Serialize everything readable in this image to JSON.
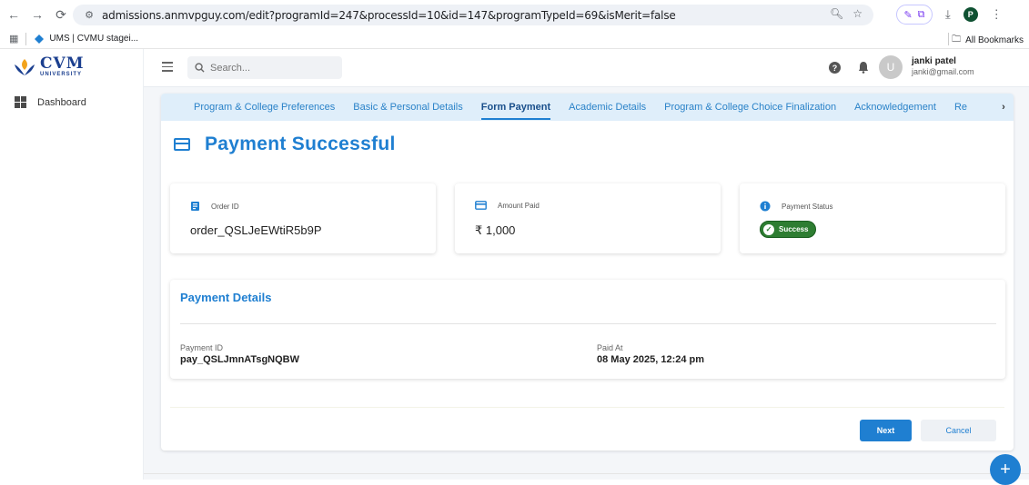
{
  "browser": {
    "url": "admissions.anmvpguy.com/edit?programId=247&processId=10&id=147&programTypeId=69&isMerit=false",
    "bookmark_1": "UMS | CVMU stagei...",
    "all_bookmarks": "All Bookmarks",
    "profile_initial": "P"
  },
  "sidebar": {
    "logo_main": "CVM",
    "logo_sub": "UNIVERSITY",
    "dashboard_label": "Dashboard"
  },
  "topbar": {
    "search_placeholder": "Search...",
    "avatar_initial": "U",
    "user_name": "janki patel",
    "user_email": "janki@gmail.com"
  },
  "tabs": [
    {
      "label": "Program & College Preferences"
    },
    {
      "label": "Basic & Personal Details"
    },
    {
      "label": "Form Payment"
    },
    {
      "label": "Academic Details"
    },
    {
      "label": "Program & College Choice Finalization"
    },
    {
      "label": "Acknowledgement"
    },
    {
      "label": "Re"
    }
  ],
  "page": {
    "title": "Payment Successful"
  },
  "order": {
    "label": "Order ID",
    "value": "order_QSLJeEWtiR5b9P"
  },
  "amount": {
    "label": "Amount Paid",
    "value": "₹ 1,000"
  },
  "status": {
    "label": "Payment Status",
    "value": "Success"
  },
  "details": {
    "title": "Payment Details",
    "payment_id_label": "Payment ID",
    "payment_id_value": "pay_QSLJmnATsgNQBW",
    "paid_at_label": "Paid At",
    "paid_at_value": "08 May 2025, 12:24 pm"
  },
  "actions": {
    "next_label": "Next",
    "cancel_label": "Cancel",
    "fab_label": "+"
  },
  "colors": {
    "accent": "#1f7fd1",
    "success": "#2e7d32",
    "tab_bg": "#dfeefa"
  }
}
